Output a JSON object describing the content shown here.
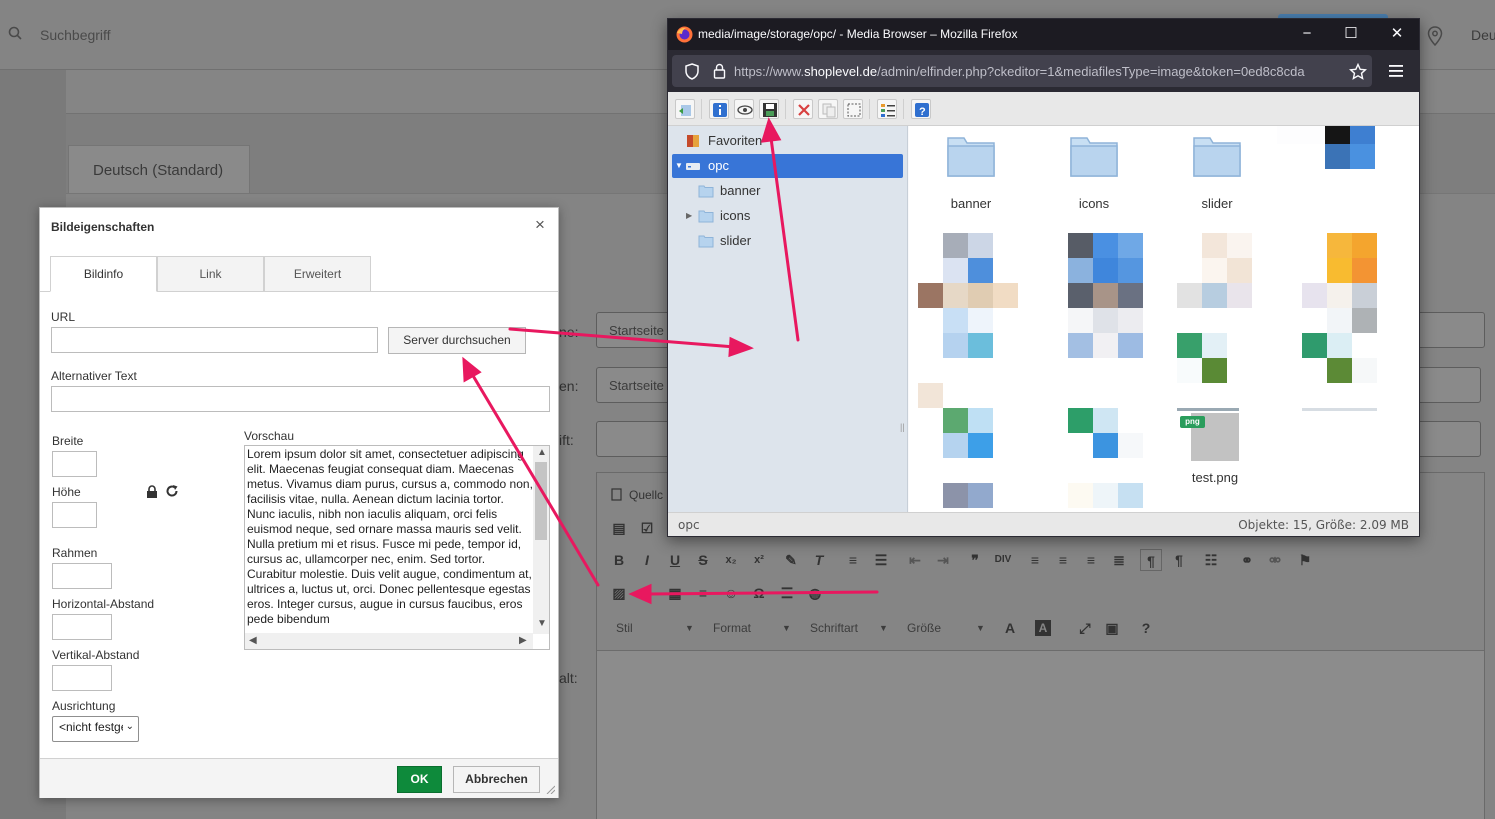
{
  "background": {
    "search_placeholder": "Suchbegriff",
    "lang_short": "Deu",
    "tab_label": "Deutsch (Standard)",
    "field_values": [
      "Startseite",
      "Startseite"
    ],
    "label_fragments": [
      "ne:",
      "en:",
      "ift:",
      "alt:"
    ],
    "editor_source_label": "Quellc",
    "combos": [
      "Stil",
      "Format",
      "Schriftart",
      "Größe"
    ]
  },
  "dialog": {
    "title": "Bildeigenschaften",
    "close_glyph": "×",
    "tabs": [
      "Bildinfo",
      "Link",
      "Erweitert"
    ],
    "url_label": "URL",
    "url_value": "",
    "browse_button": "Server durchsuchen",
    "alt_label": "Alternativer Text",
    "alt_value": "",
    "width_label": "Breite",
    "height_label": "Höhe",
    "border_label": "Rahmen",
    "hspace_label": "Horizontal-Abstand",
    "vspace_label": "Vertikal-Abstand",
    "align_label": "Ausrichtung",
    "align_value": "<nicht festgelegt>",
    "preview_label": "Vorschau",
    "preview_text": "Lorem ipsum dolor sit amet, consectetuer adipiscing elit. Maecenas feugiat consequat diam. Maecenas metus. Vivamus diam purus, cursus a, commodo non, facilisis vitae, nulla. Aenean dictum lacinia tortor. Nunc iaculis, nibh non iaculis aliquam, orci felis euismod neque, sed ornare massa mauris sed velit. Nulla pretium mi et risus. Fusce mi pede, tempor id, cursus ac, ullamcorper nec, enim. Sed tortor. Curabitur molestie. Duis velit augue, condimentum at, ultrices a, luctus ut, orci. Donec pellentesque egestas eros. Integer cursus, augue in cursus faucibus, eros pede bibendum",
    "ok_button": "OK",
    "cancel_button": "Abbrechen"
  },
  "firefox": {
    "title": "media/image/storage/opc/ - Media Browser – Mozilla Firefox",
    "url_prefix": "https://www.",
    "url_domain": "shoplevel.de",
    "url_rest": "/admin/elfinder.php?ckeditor=1&mediafilesType=image&token=0ed8c8cda",
    "tree": {
      "favorites": "Favoriten",
      "root": "opc",
      "children": [
        "banner",
        "icons",
        "slider"
      ]
    },
    "folders": [
      "banner",
      "icons",
      "slider"
    ],
    "png_badge": "png",
    "png_file": "test.png",
    "status_path": "opc",
    "status_info": "Objekte: 15, Größe: 2.09 MB"
  },
  "colors": {
    "accent_green": "#0e8a3b",
    "selection_blue": "#3875d7",
    "arrow_pink": "#e8185f"
  }
}
